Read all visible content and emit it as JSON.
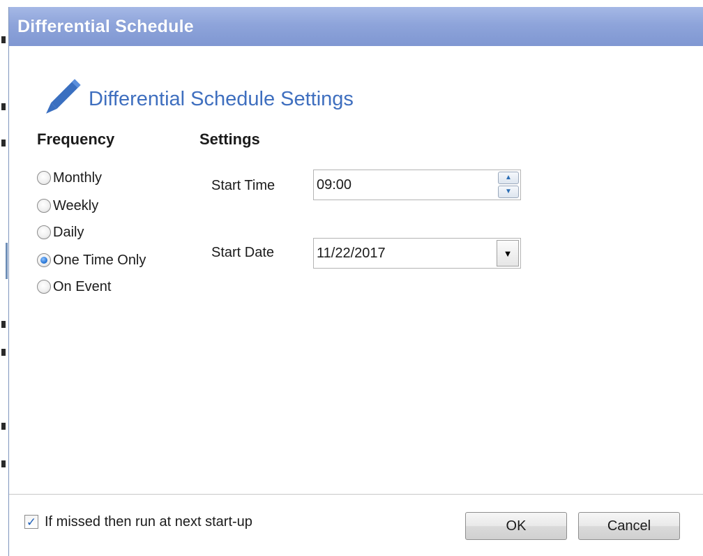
{
  "window": {
    "title": "Differential Schedule"
  },
  "header": {
    "heading": "Differential Schedule Settings",
    "icon": "pencil-icon"
  },
  "frequency": {
    "title": "Frequency",
    "options": [
      {
        "label": "Monthly",
        "checked": false
      },
      {
        "label": "Weekly",
        "checked": false
      },
      {
        "label": "Daily",
        "checked": false
      },
      {
        "label": "One Time Only",
        "checked": true
      },
      {
        "label": "On Event",
        "checked": false
      }
    ]
  },
  "settings": {
    "title": "Settings",
    "start_time": {
      "label": "Start Time",
      "value": "09:00"
    },
    "start_date": {
      "label": "Start Date",
      "value": "11/22/2017"
    }
  },
  "footer": {
    "missed_checkbox": {
      "label": "If missed then run at next start-up",
      "checked": true
    },
    "ok_label": "OK",
    "cancel_label": "Cancel"
  },
  "colors": {
    "titlebar": "#8ea4da",
    "heading": "#3f6fbf",
    "pencil": "#3a6fc0",
    "radio_selected": "#2c79d8"
  }
}
